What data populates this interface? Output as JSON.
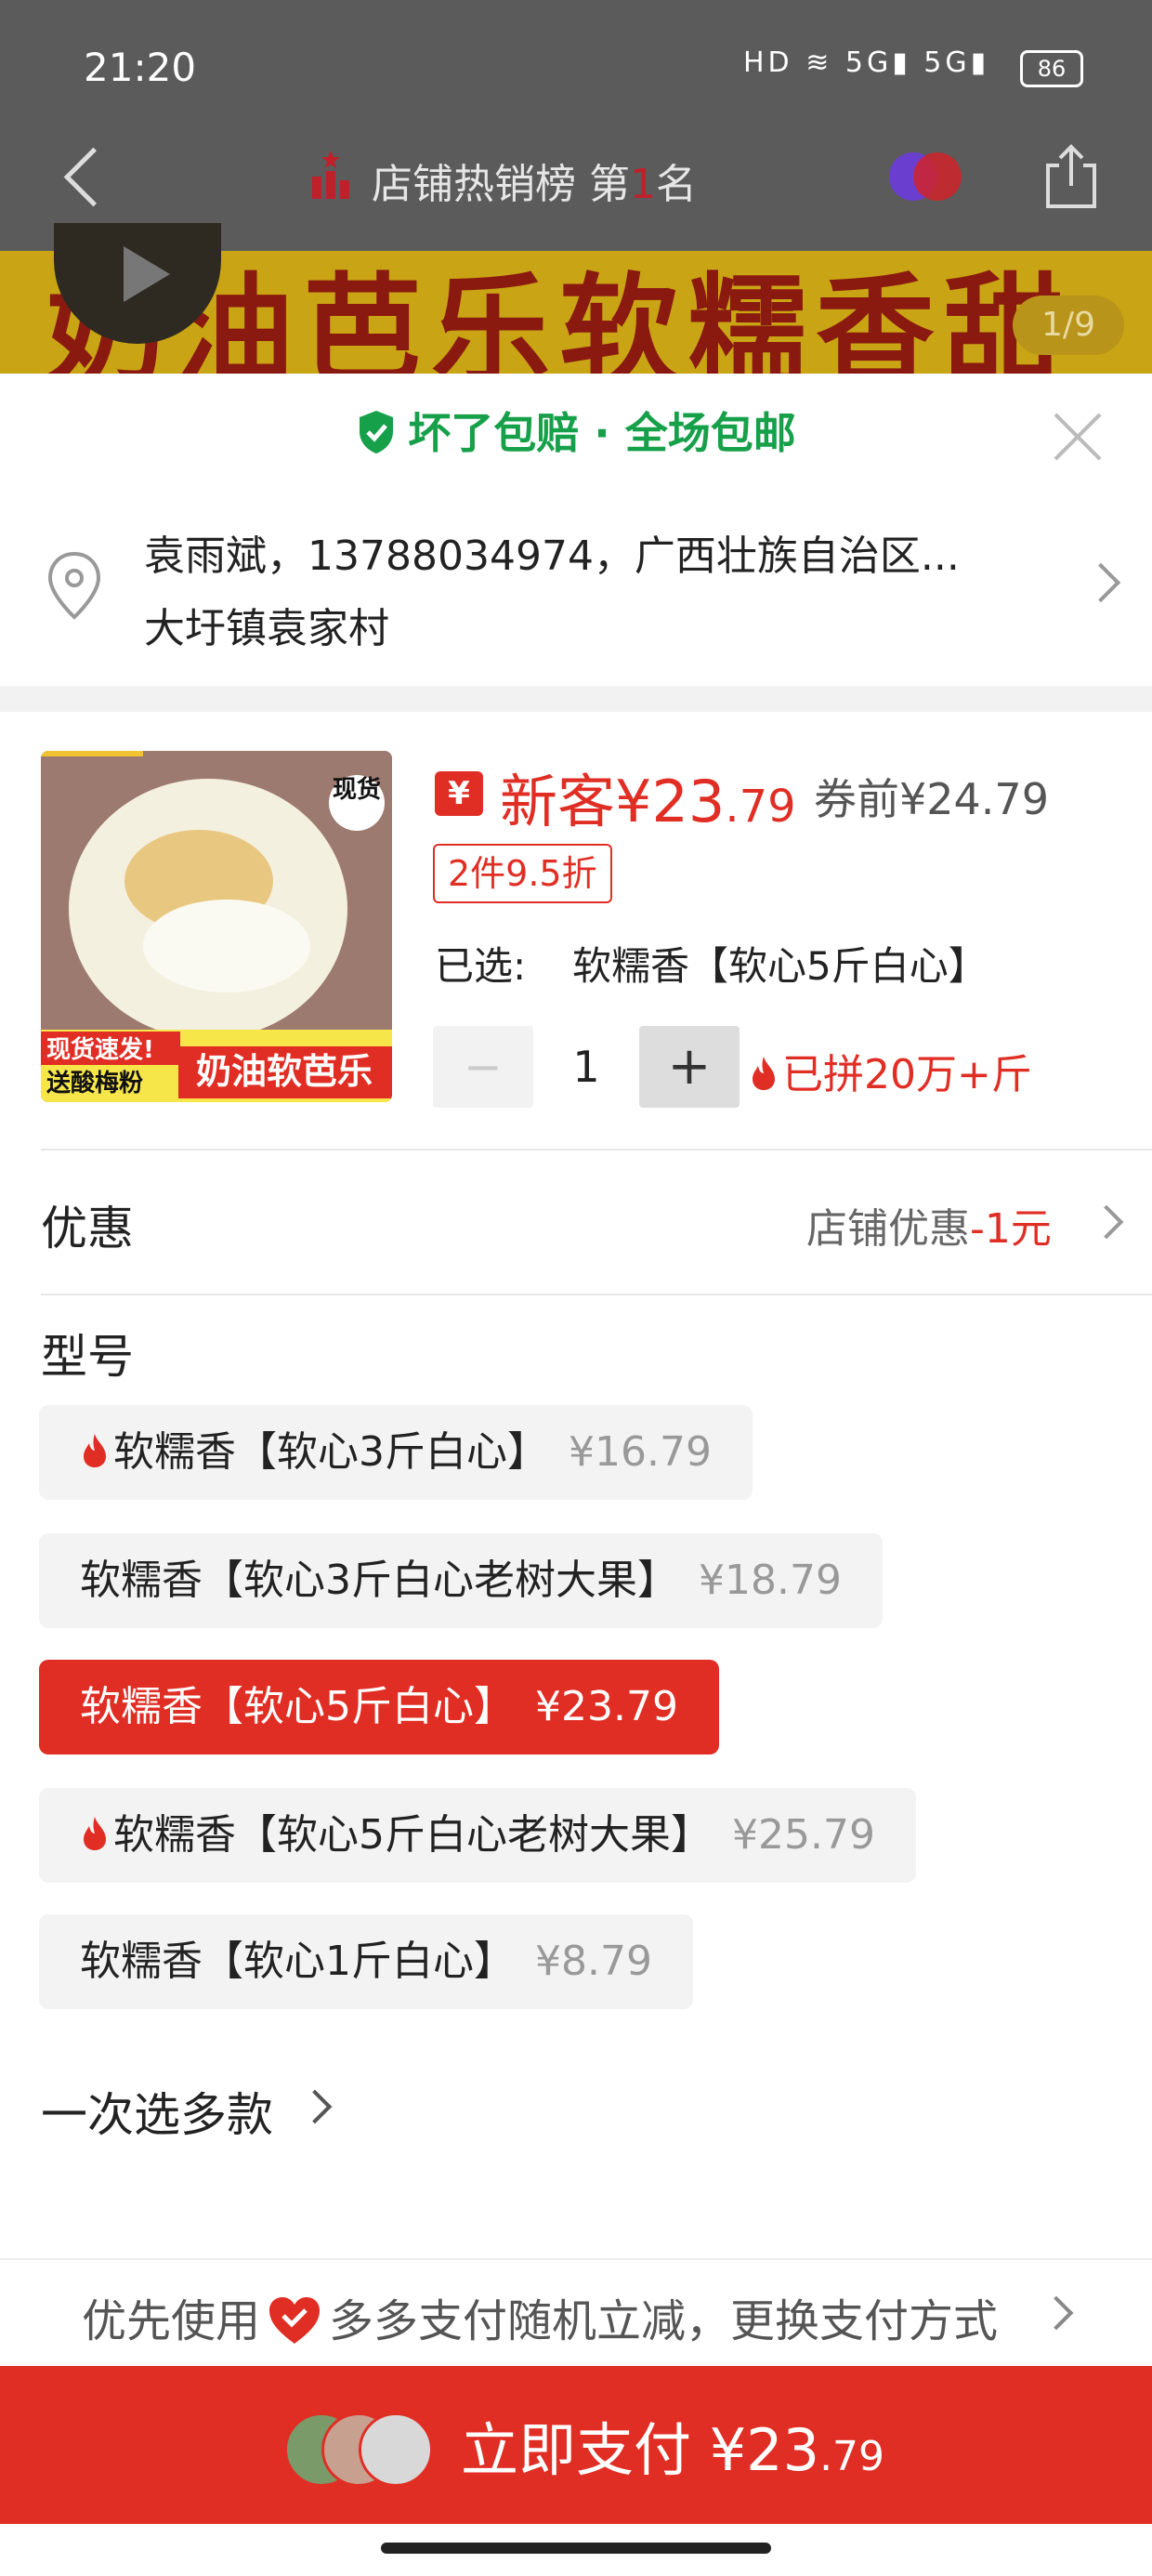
{
  "status_bar": {
    "time": "21:20",
    "battery": "86",
    "icons": "HD ≋ 5G▮ 5G▮"
  },
  "nav": {
    "rank_prefix": "店铺热销榜 第",
    "rank_number": "1",
    "rank_suffix": "名"
  },
  "banner": {
    "text": "奶油芭乐软糯香甜",
    "counter": "1/9"
  },
  "guarantee": "坏了包赔 · 全场包邮",
  "address": {
    "line1": "袁雨斌，13788034974，广西壮族自治区...",
    "line2": "大圩镇袁家村"
  },
  "product": {
    "image_badge": "现货",
    "image_caption_1": "现货速发!",
    "image_caption_2": "送酸梅粉",
    "image_caption_3": "奶油软芭乐",
    "coupon_icon": "¥",
    "price_prefix": "新客¥23",
    "price_cents": ".79",
    "original_price": "券前¥24.79",
    "discount": "2件9.5折",
    "selected_label": "已选:",
    "selected_value": "软糯香【软心5斤白心】",
    "quantity": "1",
    "minus": "−",
    "plus": "+",
    "sold": "已拼20万+斤"
  },
  "promo": {
    "label": "优惠",
    "value_prefix": "店铺优惠",
    "value_amount": "-1元"
  },
  "model": {
    "label": "型号",
    "options": [
      {
        "name": "软糯香【软心3斤白心】",
        "price": "¥16.79",
        "hot": true,
        "selected": false
      },
      {
        "name": "软糯香【软心3斤白心老树大果】",
        "price": "¥18.79",
        "hot": false,
        "selected": false
      },
      {
        "name": "软糯香【软心5斤白心】",
        "price": "¥23.79",
        "hot": false,
        "selected": true
      },
      {
        "name": "软糯香【软心5斤白心老树大果】",
        "price": "¥25.79",
        "hot": true,
        "selected": false
      },
      {
        "name": "软糯香【软心1斤白心】",
        "price": "¥8.79",
        "hot": false,
        "selected": false
      }
    ]
  },
  "multi_select": "一次选多款",
  "payment": {
    "prefix": "优先使用",
    "suffix": "多多支付随机立减，更换支付方式"
  },
  "pay_button": {
    "label": "立即支付 ¥23",
    "cents": ".79"
  },
  "colors": {
    "accent": "#e02e24",
    "green": "#17a04a"
  }
}
